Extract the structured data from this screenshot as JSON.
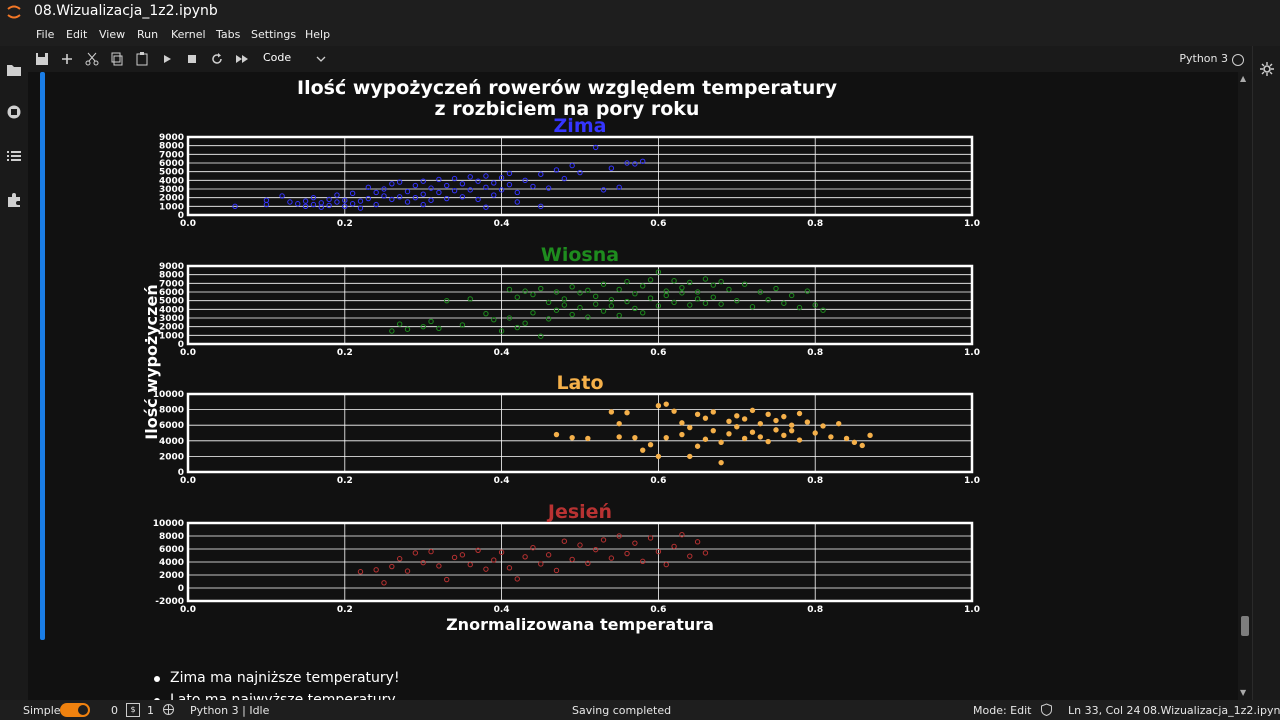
{
  "window": {
    "title": "08.Wizualizacja_1z2.ipynb"
  },
  "menu": [
    "File",
    "Edit",
    "View",
    "Run",
    "Kernel",
    "Tabs",
    "Settings",
    "Help"
  ],
  "toolbar": {
    "cell_type": "Code",
    "kernel_name": "Python 3"
  },
  "markdown": {
    "items": [
      "Zima ma najniższe temperatury!",
      "Lato ma najwyższe temperatury"
    ]
  },
  "statusbar": {
    "mode_label": "Simple",
    "terminals_count": "0",
    "kernels_count": "1",
    "kernel": "Python 3 | Idle",
    "message": "Saving completed",
    "mode": "Mode: Edit",
    "position": "Ln 33, Col 24",
    "file": "08.Wizualizacja_1z2.ipynb"
  },
  "colors": {
    "accent_blue": "#1a7de6",
    "toggle_orange": "#f0820f"
  },
  "chart_data": {
    "type": "scatter",
    "title": "Ilość wypożyczeń rowerów względem temperatury\nz rozbiciem na pory roku",
    "xlabel": "Znormalizowana temperatura",
    "ylabel": "Ilość wypożyczeń",
    "xlim": [
      0.0,
      1.0
    ],
    "x_ticks": [
      "0.0",
      "0.2",
      "0.4",
      "0.6",
      "0.8",
      "1.0"
    ],
    "grid": true,
    "panels": [
      {
        "name": "Zima",
        "color": "#3535ff",
        "filled": false,
        "ylim": [
          0,
          9000
        ],
        "y_ticks": [
          "0",
          "1000",
          "2000",
          "3000",
          "4000",
          "5000",
          "6000",
          "7000",
          "8000",
          "9000"
        ],
        "points": [
          [
            0.06,
            1000
          ],
          [
            0.1,
            1200
          ],
          [
            0.1,
            1700
          ],
          [
            0.12,
            2200
          ],
          [
            0.13,
            1500
          ],
          [
            0.14,
            1300
          ],
          [
            0.15,
            1600
          ],
          [
            0.15,
            1000
          ],
          [
            0.16,
            2000
          ],
          [
            0.16,
            1200
          ],
          [
            0.17,
            1400
          ],
          [
            0.17,
            900
          ],
          [
            0.18,
            1800
          ],
          [
            0.18,
            1100
          ],
          [
            0.19,
            1500
          ],
          [
            0.19,
            2300
          ],
          [
            0.2,
            1000
          ],
          [
            0.2,
            1700
          ],
          [
            0.21,
            1300
          ],
          [
            0.21,
            2500
          ],
          [
            0.22,
            1600
          ],
          [
            0.22,
            800
          ],
          [
            0.23,
            1900
          ],
          [
            0.23,
            3200
          ],
          [
            0.24,
            2600
          ],
          [
            0.24,
            1200
          ],
          [
            0.25,
            2200
          ],
          [
            0.25,
            3000
          ],
          [
            0.26,
            1800
          ],
          [
            0.26,
            3600
          ],
          [
            0.27,
            2100
          ],
          [
            0.27,
            3800
          ],
          [
            0.28,
            1500
          ],
          [
            0.28,
            2700
          ],
          [
            0.29,
            3400
          ],
          [
            0.29,
            2000
          ],
          [
            0.3,
            3900
          ],
          [
            0.3,
            2400
          ],
          [
            0.31,
            1700
          ],
          [
            0.31,
            3100
          ],
          [
            0.32,
            2600
          ],
          [
            0.32,
            4100
          ],
          [
            0.33,
            1900
          ],
          [
            0.33,
            3400
          ],
          [
            0.34,
            2800
          ],
          [
            0.34,
            4200
          ],
          [
            0.35,
            2100
          ],
          [
            0.35,
            3600
          ],
          [
            0.36,
            4400
          ],
          [
            0.36,
            2900
          ],
          [
            0.37,
            1800
          ],
          [
            0.37,
            3900
          ],
          [
            0.38,
            3200
          ],
          [
            0.38,
            4500
          ],
          [
            0.39,
            2300
          ],
          [
            0.39,
            3700
          ],
          [
            0.4,
            4300
          ],
          [
            0.4,
            2900
          ],
          [
            0.41,
            3500
          ],
          [
            0.41,
            4800
          ],
          [
            0.42,
            2600
          ],
          [
            0.43,
            4000
          ],
          [
            0.44,
            3300
          ],
          [
            0.45,
            4700
          ],
          [
            0.46,
            3100
          ],
          [
            0.47,
            5200
          ],
          [
            0.48,
            4200
          ],
          [
            0.49,
            5700
          ],
          [
            0.5,
            4900
          ],
          [
            0.52,
            7800
          ],
          [
            0.53,
            2900
          ],
          [
            0.54,
            5400
          ],
          [
            0.55,
            3200
          ],
          [
            0.56,
            6000
          ],
          [
            0.57,
            5900
          ],
          [
            0.58,
            6200
          ],
          [
            0.45,
            1000
          ],
          [
            0.42,
            1500
          ],
          [
            0.38,
            900
          ],
          [
            0.3,
            1200
          ]
        ]
      },
      {
        "name": "Wiosna",
        "color": "#1e8c1e",
        "filled": false,
        "ylim": [
          0,
          9000
        ],
        "y_ticks": [
          "0",
          "1000",
          "2000",
          "3000",
          "4000",
          "5000",
          "6000",
          "7000",
          "8000",
          "9000"
        ],
        "points": [
          [
            0.26,
            1500
          ],
          [
            0.27,
            2300
          ],
          [
            0.28,
            1700
          ],
          [
            0.3,
            2000
          ],
          [
            0.31,
            2600
          ],
          [
            0.32,
            1800
          ],
          [
            0.33,
            5000
          ],
          [
            0.35,
            2200
          ],
          [
            0.36,
            5200
          ],
          [
            0.38,
            3500
          ],
          [
            0.39,
            2800
          ],
          [
            0.4,
            1500
          ],
          [
            0.41,
            6300
          ],
          [
            0.41,
            3000
          ],
          [
            0.42,
            5400
          ],
          [
            0.42,
            1900
          ],
          [
            0.43,
            6100
          ],
          [
            0.43,
            2400
          ],
          [
            0.44,
            5700
          ],
          [
            0.44,
            3600
          ],
          [
            0.45,
            6400
          ],
          [
            0.45,
            900
          ],
          [
            0.46,
            4800
          ],
          [
            0.46,
            2900
          ],
          [
            0.47,
            6000
          ],
          [
            0.47,
            3900
          ],
          [
            0.48,
            5200
          ],
          [
            0.48,
            4500
          ],
          [
            0.49,
            6600
          ],
          [
            0.49,
            3400
          ],
          [
            0.5,
            5900
          ],
          [
            0.5,
            4200
          ],
          [
            0.51,
            6200
          ],
          [
            0.51,
            3100
          ],
          [
            0.52,
            5500
          ],
          [
            0.52,
            4600
          ],
          [
            0.53,
            6900
          ],
          [
            0.53,
            3800
          ],
          [
            0.54,
            5100
          ],
          [
            0.54,
            4400
          ],
          [
            0.55,
            6300
          ],
          [
            0.55,
            3300
          ],
          [
            0.56,
            7200
          ],
          [
            0.56,
            4900
          ],
          [
            0.57,
            5800
          ],
          [
            0.57,
            4100
          ],
          [
            0.58,
            6700
          ],
          [
            0.58,
            3600
          ],
          [
            0.59,
            7400
          ],
          [
            0.59,
            5300
          ],
          [
            0.6,
            8300
          ],
          [
            0.6,
            4400
          ],
          [
            0.61,
            6100
          ],
          [
            0.61,
            5600
          ],
          [
            0.62,
            7300
          ],
          [
            0.62,
            4800
          ],
          [
            0.63,
            6500
          ],
          [
            0.63,
            5900
          ],
          [
            0.64,
            7100
          ],
          [
            0.64,
            4500
          ],
          [
            0.65,
            6000
          ],
          [
            0.65,
            5200
          ],
          [
            0.66,
            7500
          ],
          [
            0.66,
            4700
          ],
          [
            0.67,
            6800
          ],
          [
            0.67,
            5400
          ],
          [
            0.68,
            7200
          ],
          [
            0.68,
            4600
          ],
          [
            0.69,
            6300
          ],
          [
            0.7,
            5000
          ],
          [
            0.71,
            6900
          ],
          [
            0.72,
            4300
          ],
          [
            0.73,
            6000
          ],
          [
            0.74,
            5100
          ],
          [
            0.75,
            6400
          ],
          [
            0.76,
            4700
          ],
          [
            0.77,
            5600
          ],
          [
            0.78,
            4200
          ],
          [
            0.79,
            6100
          ],
          [
            0.8,
            4500
          ],
          [
            0.81,
            3900
          ]
        ]
      },
      {
        "name": "Lato",
        "color": "#f5b04a",
        "filled": true,
        "ylim": [
          0,
          10000
        ],
        "y_ticks": [
          "0",
          "2000",
          "4000",
          "6000",
          "8000",
          "10000"
        ],
        "points": [
          [
            0.47,
            4800
          ],
          [
            0.49,
            4400
          ],
          [
            0.51,
            4300
          ],
          [
            0.54,
            7700
          ],
          [
            0.55,
            6200
          ],
          [
            0.56,
            7600
          ],
          [
            0.55,
            4500
          ],
          [
            0.57,
            4400
          ],
          [
            0.58,
            2800
          ],
          [
            0.59,
            3500
          ],
          [
            0.6,
            8500
          ],
          [
            0.6,
            2000
          ],
          [
            0.61,
            8700
          ],
          [
            0.61,
            4400
          ],
          [
            0.62,
            7800
          ],
          [
            0.63,
            6300
          ],
          [
            0.63,
            4800
          ],
          [
            0.64,
            5700
          ],
          [
            0.64,
            2000
          ],
          [
            0.65,
            7400
          ],
          [
            0.65,
            3300
          ],
          [
            0.66,
            6900
          ],
          [
            0.66,
            4200
          ],
          [
            0.67,
            5300
          ],
          [
            0.67,
            7700
          ],
          [
            0.68,
            3800
          ],
          [
            0.68,
            1200
          ],
          [
            0.69,
            6500
          ],
          [
            0.69,
            4900
          ],
          [
            0.7,
            7200
          ],
          [
            0.7,
            5800
          ],
          [
            0.71,
            4300
          ],
          [
            0.71,
            6800
          ],
          [
            0.72,
            7900
          ],
          [
            0.72,
            5100
          ],
          [
            0.73,
            6200
          ],
          [
            0.73,
            4500
          ],
          [
            0.74,
            7400
          ],
          [
            0.74,
            3900
          ],
          [
            0.75,
            6600
          ],
          [
            0.75,
            5400
          ],
          [
            0.76,
            7100
          ],
          [
            0.76,
            4700
          ],
          [
            0.77,
            6000
          ],
          [
            0.77,
            5300
          ],
          [
            0.78,
            7500
          ],
          [
            0.78,
            4100
          ],
          [
            0.79,
            6400
          ],
          [
            0.8,
            5000
          ],
          [
            0.81,
            5900
          ],
          [
            0.82,
            4500
          ],
          [
            0.83,
            6200
          ],
          [
            0.84,
            4300
          ],
          [
            0.85,
            3800
          ],
          [
            0.86,
            3400
          ],
          [
            0.87,
            4700
          ]
        ]
      },
      {
        "name": "Jesień",
        "color": "#b83232",
        "filled": false,
        "ylim": [
          -2000,
          10000
        ],
        "y_ticks": [
          "-2000",
          "0",
          "2000",
          "4000",
          "6000",
          "8000",
          "10000"
        ],
        "points": [
          [
            0.22,
            2500
          ],
          [
            0.24,
            2800
          ],
          [
            0.25,
            800
          ],
          [
            0.26,
            3300
          ],
          [
            0.27,
            4500
          ],
          [
            0.28,
            2600
          ],
          [
            0.29,
            5400
          ],
          [
            0.3,
            3900
          ],
          [
            0.31,
            5600
          ],
          [
            0.32,
            3400
          ],
          [
            0.33,
            1300
          ],
          [
            0.34,
            4700
          ],
          [
            0.35,
            5100
          ],
          [
            0.36,
            3600
          ],
          [
            0.37,
            5800
          ],
          [
            0.38,
            2900
          ],
          [
            0.39,
            4300
          ],
          [
            0.4,
            5500
          ],
          [
            0.41,
            3100
          ],
          [
            0.42,
            1400
          ],
          [
            0.43,
            4800
          ],
          [
            0.44,
            6200
          ],
          [
            0.45,
            3700
          ],
          [
            0.46,
            5100
          ],
          [
            0.47,
            2700
          ],
          [
            0.48,
            7200
          ],
          [
            0.49,
            4400
          ],
          [
            0.5,
            6600
          ],
          [
            0.51,
            3800
          ],
          [
            0.52,
            5900
          ],
          [
            0.53,
            7400
          ],
          [
            0.54,
            4600
          ],
          [
            0.55,
            8000
          ],
          [
            0.56,
            5300
          ],
          [
            0.57,
            6900
          ],
          [
            0.58,
            4100
          ],
          [
            0.59,
            7700
          ],
          [
            0.6,
            5600
          ],
          [
            0.61,
            3600
          ],
          [
            0.62,
            6400
          ],
          [
            0.63,
            8200
          ],
          [
            0.64,
            4900
          ],
          [
            0.65,
            7100
          ],
          [
            0.66,
            5400
          ]
        ]
      }
    ]
  }
}
